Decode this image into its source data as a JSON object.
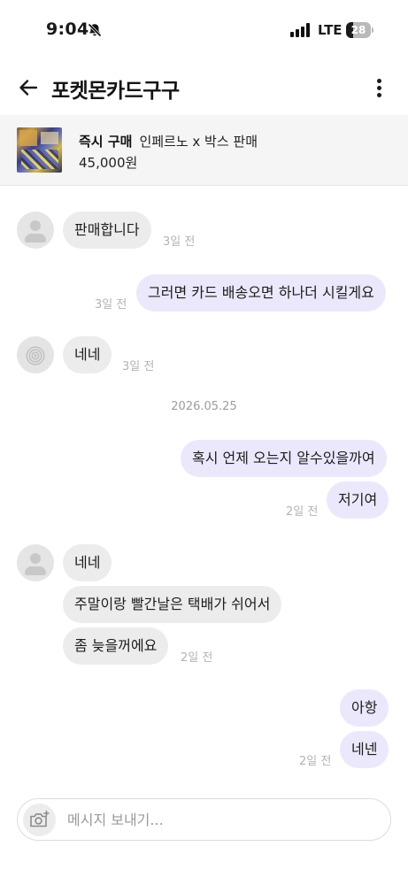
{
  "status_bar": {
    "time": "9:04",
    "network": "LTE",
    "battery": "28",
    "battery_level": 0.28
  },
  "header": {
    "title": "포켓몬카드구구"
  },
  "product": {
    "type": "즉시 구매",
    "name": "인페르노 x 박스 판매",
    "price": "45,000원"
  },
  "messages": [
    {
      "sender": "other",
      "text": "판매합니다",
      "time": "3일 전"
    },
    {
      "sender": "me",
      "text": "그러면 카드 배송오면 하나더 시킬게요",
      "time": "3일 전"
    },
    {
      "sender": "other",
      "text": "네네",
      "time": "3일 전"
    },
    {
      "type": "date",
      "text": "2026.05.25"
    },
    {
      "sender": "me",
      "text": "혹시 언제 오는지 알수있을까여"
    },
    {
      "sender": "me",
      "text": "저기여",
      "time": "2일 전"
    },
    {
      "sender": "other",
      "text": "네네"
    },
    {
      "sender": "other",
      "text": "주말이랑 빨간날은 택배가 쉬어서"
    },
    {
      "sender": "other",
      "text": "좀 늦을꺼에요",
      "time": "2일 전"
    },
    {
      "sender": "me",
      "text": "아항"
    },
    {
      "sender": "me",
      "text": "네넨",
      "time": "2일 전"
    }
  ],
  "input": {
    "placeholder": "메시지 보내기..."
  },
  "icons": {
    "back": "arrow-left-icon",
    "more": "more-vertical-icon",
    "camera": "camera-add-icon",
    "silent": "bell-slash-icon",
    "signal": "cellular-signal-icon",
    "battery": "battery-icon"
  },
  "colors": {
    "outgoing_bubble": "#ebe8fc",
    "incoming_bubble": "#ececec",
    "product_bar_bg": "#f5f5f5"
  }
}
